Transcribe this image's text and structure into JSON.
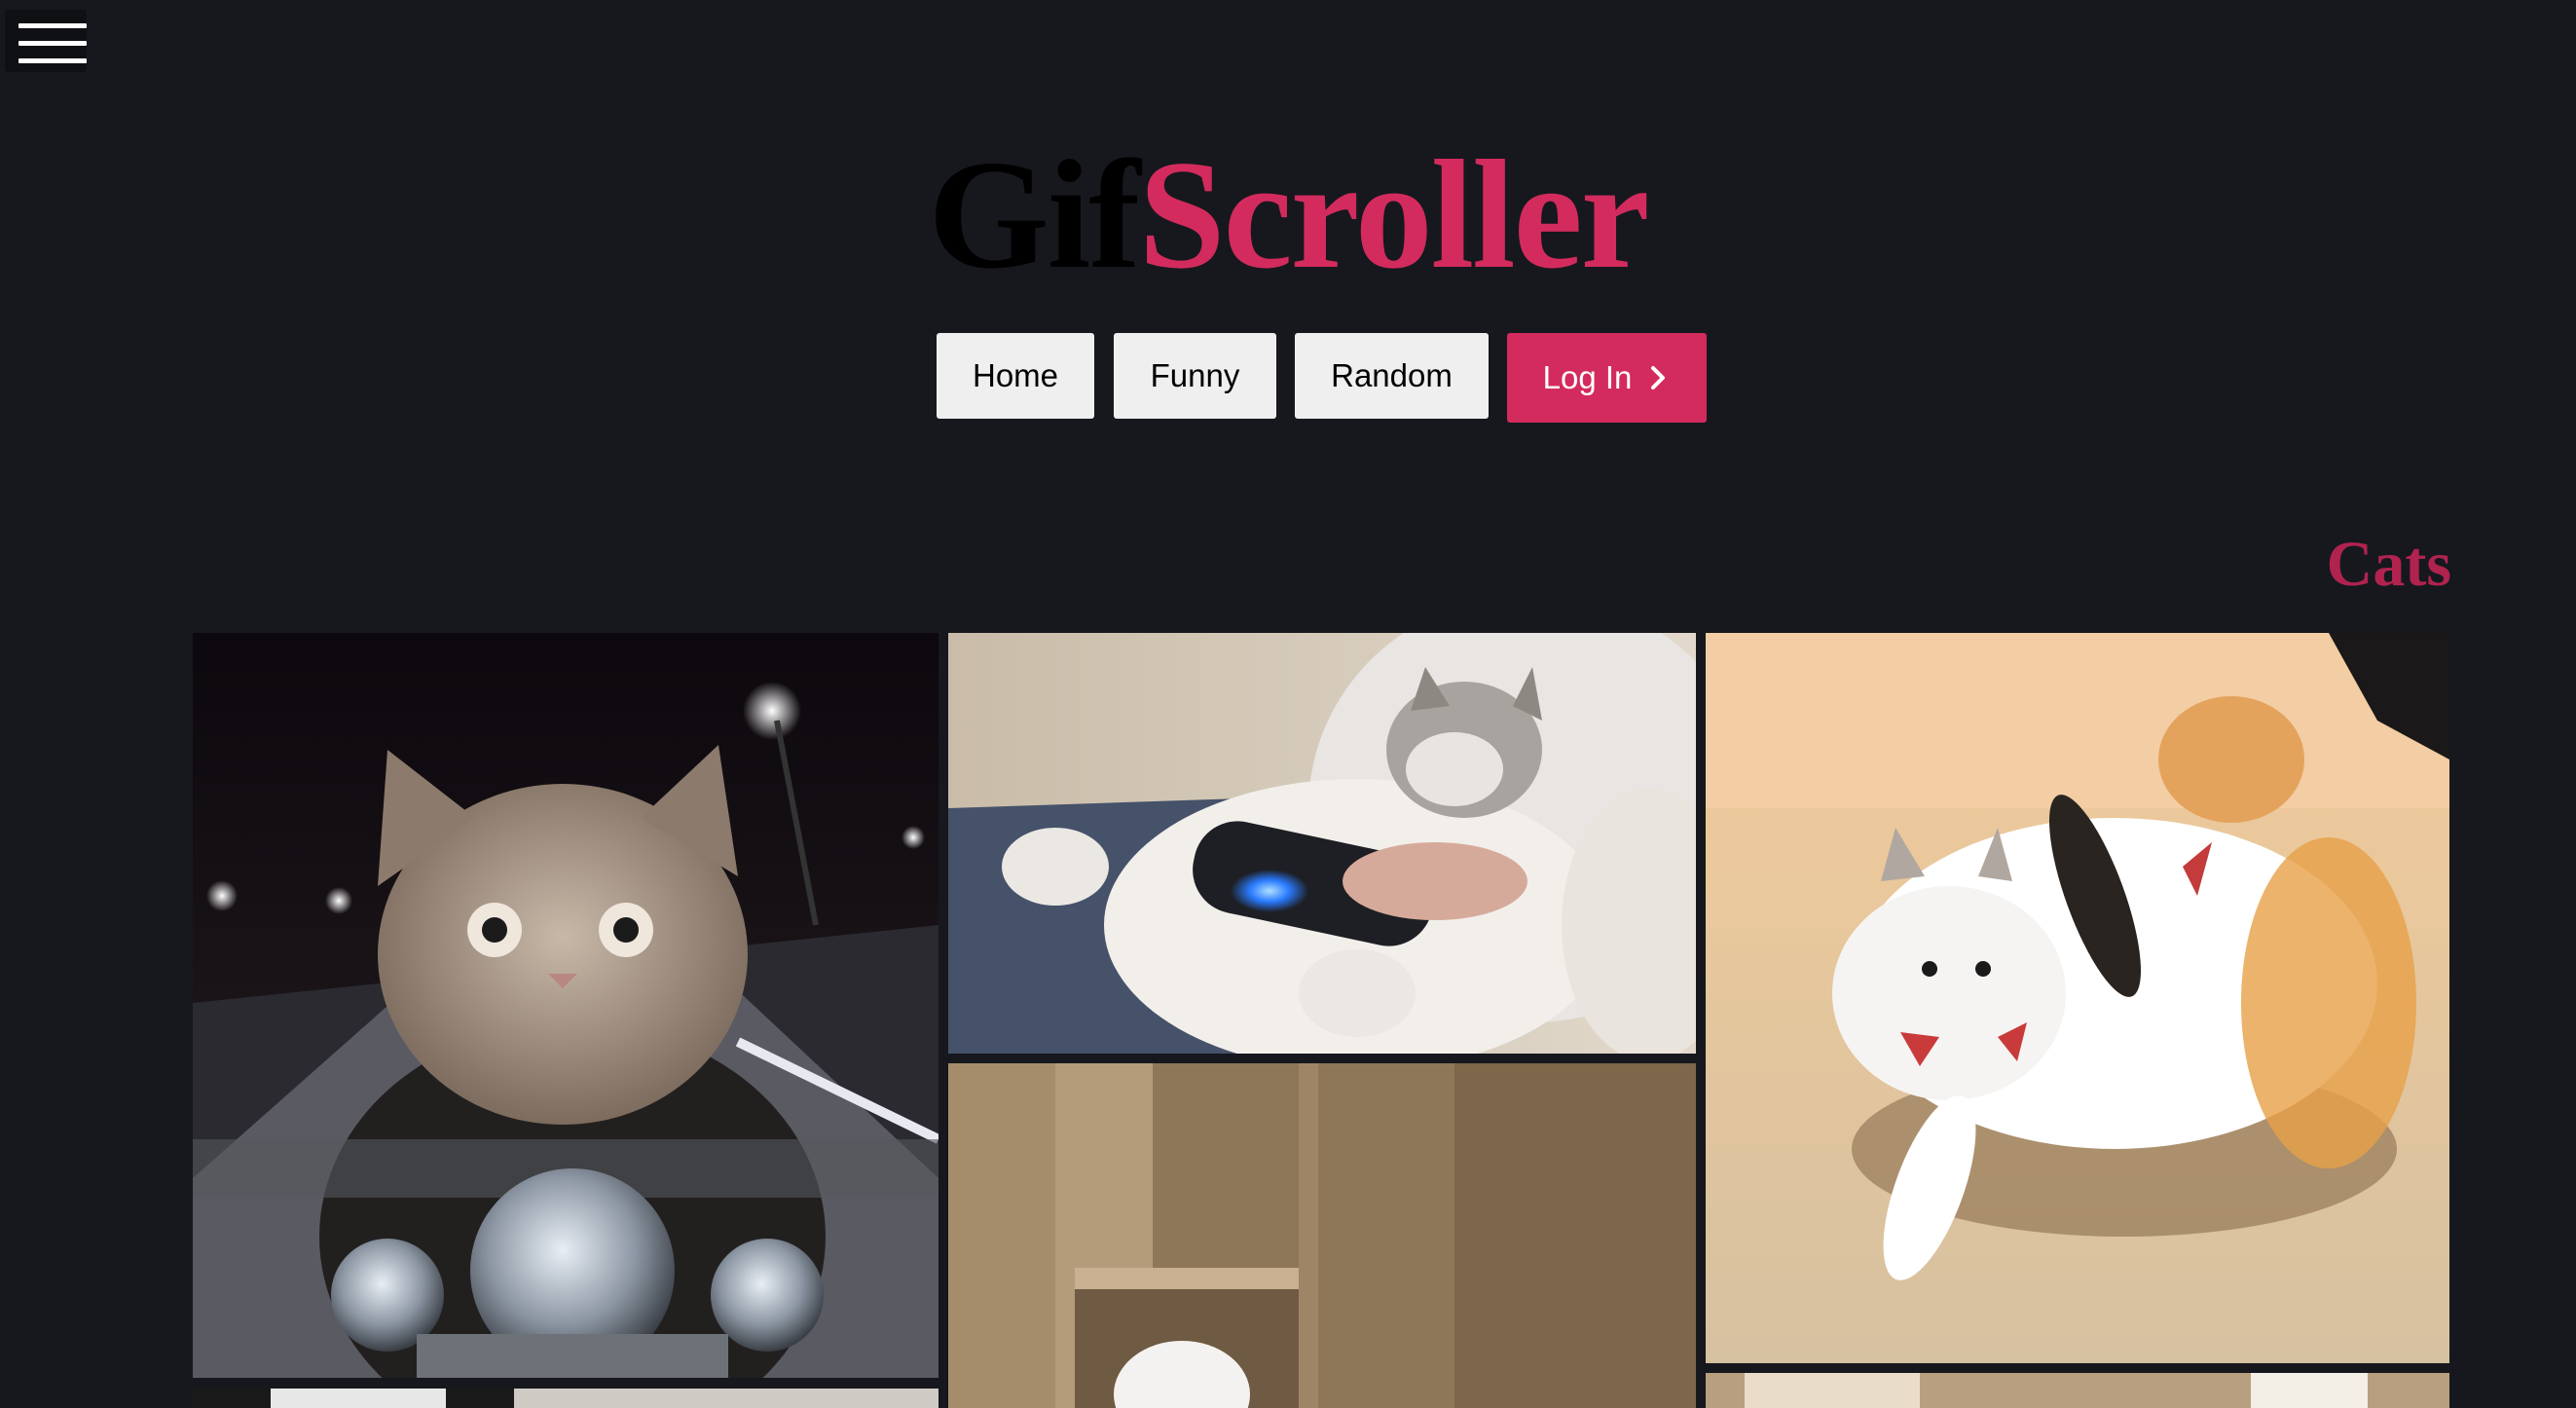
{
  "menu": {
    "icon": "hamburger-menu-icon"
  },
  "logo": {
    "part1": "Gif",
    "part2": "Scroller"
  },
  "nav": {
    "home": "Home",
    "funny": "Funny",
    "random": "Random",
    "login": "Log In",
    "login_icon": "chevron-right-icon"
  },
  "section": {
    "title": "Cats"
  },
  "gifs": [
    {
      "name": "gif-cat-motorcycle"
    },
    {
      "name": "gif-cat-video-game-controller"
    },
    {
      "name": "gif-cats-playing"
    },
    {
      "name": "gif-cat-cardboard-box"
    },
    {
      "name": "gif-bottom-left"
    },
    {
      "name": "gif-bottom-right"
    }
  ],
  "colors": {
    "background": "#16181d",
    "accent": "#d32b5e",
    "section_title": "#b0234f",
    "button_bg": "#efefef"
  }
}
